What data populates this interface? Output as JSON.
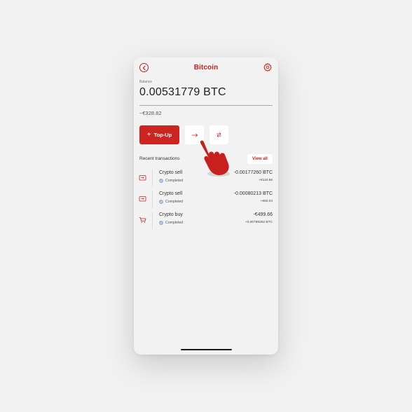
{
  "header": {
    "title": "Bitcoin",
    "back_icon": "back-arrow-circle-icon",
    "settings_icon": "settings-gear-icon"
  },
  "balance": {
    "label": "Balance",
    "value": "0.00531779 BTC",
    "fiat": "~€328.82"
  },
  "actions": {
    "topup_label": "Top-Up",
    "send_icon": "arrow-right-icon",
    "swap_icon": "swap-arrows-icon"
  },
  "recent": {
    "title": "Recent transactions",
    "view_all": "View all"
  },
  "transactions": [
    {
      "icon": "card-in-icon",
      "name": "Crypto sell",
      "status": "Completed",
      "amount": "-0.00177260 BTC",
      "sub": "+€110.56"
    },
    {
      "icon": "card-in-icon",
      "name": "Crypto sell",
      "status": "Completed",
      "amount": "-0.00080213 BTC",
      "sub": "+€50.04"
    },
    {
      "icon": "cart-icon",
      "name": "Crypto buy",
      "status": "Completed",
      "amount": "-€499.66",
      "sub": "+0.00789252 BTC"
    }
  ],
  "colors": {
    "brand_red": "#c8201f",
    "status_blue": "#9ab3d4",
    "background": "#f2f2f2"
  },
  "overlay": {
    "pointer_icon": "tap-hand-pointer-icon"
  }
}
